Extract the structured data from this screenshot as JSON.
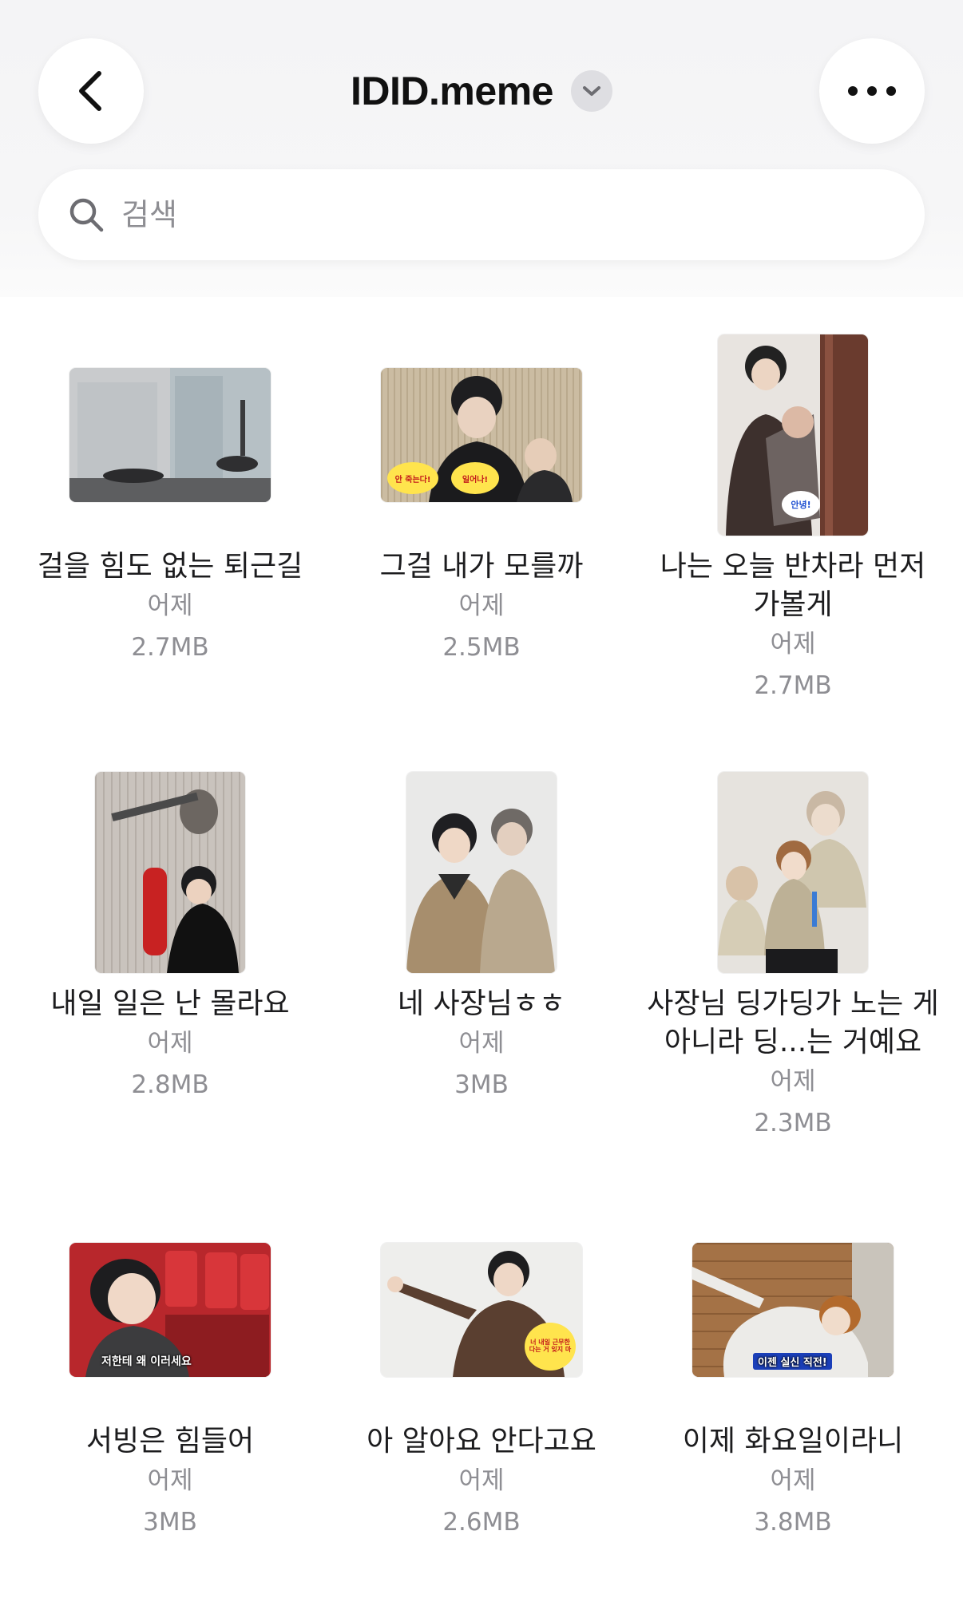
{
  "header": {
    "title": "IDID.meme",
    "back_icon": "chevron-left-icon",
    "title_menu_icon": "chevron-down-icon",
    "more_icon": "ellipsis-icon"
  },
  "search": {
    "placeholder": "검색",
    "icon": "search-icon"
  },
  "files": [
    {
      "title": "걸을 힘도 없는 퇴근길",
      "date": "어제",
      "size": "2.7MB"
    },
    {
      "title": "그걸 내가 모를까",
      "date": "어제",
      "size": "2.5MB",
      "sticker_left": "안 죽는다!",
      "sticker_right": "일어나!"
    },
    {
      "title": "나는 오늘 반차라 먼저\n가볼게",
      "date": "어제",
      "size": "2.7MB",
      "sticker": "안녕!"
    },
    {
      "title": "내일 일은 난 몰라요",
      "date": "어제",
      "size": "2.8MB"
    },
    {
      "title": "네 사장님ㅎㅎ",
      "date": "어제",
      "size": "3MB"
    },
    {
      "title": "사장님 딩가딩가 노는 게\n아니라 딩...는 거예요",
      "date": "어제",
      "size": "2.3MB"
    },
    {
      "title": "서빙은 힘들어",
      "date": "어제",
      "size": "3MB",
      "caption": "저한테 왜 이러세요"
    },
    {
      "title": "아 알아요 안다고요",
      "date": "어제",
      "size": "2.6MB",
      "sticker": "너 내일 근무한다는 거 잊지 마"
    },
    {
      "title": "이제 화요일이라니",
      "date": "어제",
      "size": "3.8MB",
      "caption": "이젠 실신 직전!"
    }
  ]
}
